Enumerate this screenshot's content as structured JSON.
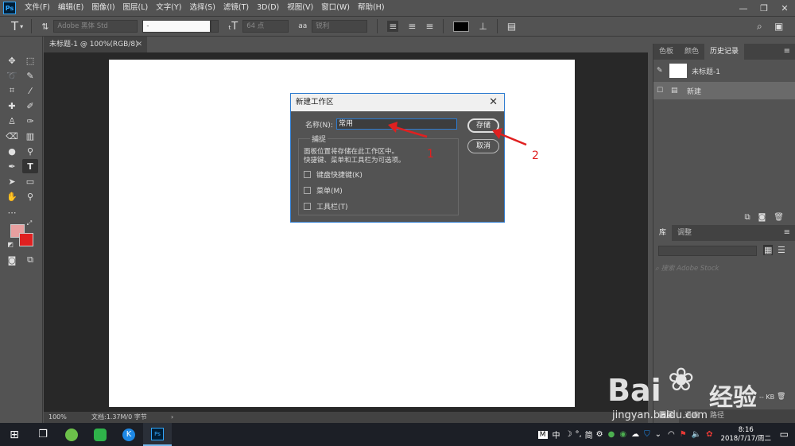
{
  "app": {
    "logo": "Ps",
    "menu": [
      "文件(F)",
      "编辑(E)",
      "图像(I)",
      "图层(L)",
      "文字(Y)",
      "选择(S)",
      "滤镜(T)",
      "3D(D)",
      "视图(V)",
      "窗口(W)",
      "帮助(H)"
    ]
  },
  "options": {
    "font_family": "Adobe 黑体 Std",
    "font_style": "-",
    "font_size": "64 点",
    "aa_label": "aa",
    "aa_mode": "锐利"
  },
  "document": {
    "tab_title": "未标题-1 @ 100%(RGB/8)",
    "zoom": "100%",
    "status": "文档:1.37M/0 字节",
    "status_arrow": "›"
  },
  "panels": {
    "top_tabs": [
      "色板",
      "颜色",
      "历史记录"
    ],
    "history_snapshot": "未标题-1",
    "history_items": [
      "新建"
    ],
    "lib_tabs": [
      "库",
      "调整"
    ],
    "search_placeholder": "搜索 Adobe Stock",
    "kb_label": "-- KB",
    "layer_tabs": [
      "图层",
      "通道",
      "路径"
    ]
  },
  "dialog": {
    "title": "新建工作区",
    "name_label": "名称(N):",
    "name_value": "常用",
    "capture_label": "捕捉",
    "description_line1": "面板位置将存储在此工作区中。",
    "description_line2": "快捷键、菜单和工具栏为可选项。",
    "checkboxes": [
      "键盘快捷键(K)",
      "菜单(M)",
      "工具栏(T)"
    ],
    "save_label": "存储",
    "cancel_label": "取消"
  },
  "annotations": [
    "1",
    "2"
  ],
  "taskbar": {
    "tray_text": [
      "M",
      "中",
      "☽",
      "°,",
      "简"
    ],
    "time": "8:16",
    "date": "2018/7/17/周二"
  },
  "watermark": {
    "brand": "Bai",
    "brand_cn": "经验",
    "url": "jingyan.baidu.com"
  },
  "colors": {
    "accent": "#2d7bd0",
    "foreground_swatch": "#e8a0a0",
    "background_swatch": "#e02020",
    "annotation": "#e02020"
  }
}
